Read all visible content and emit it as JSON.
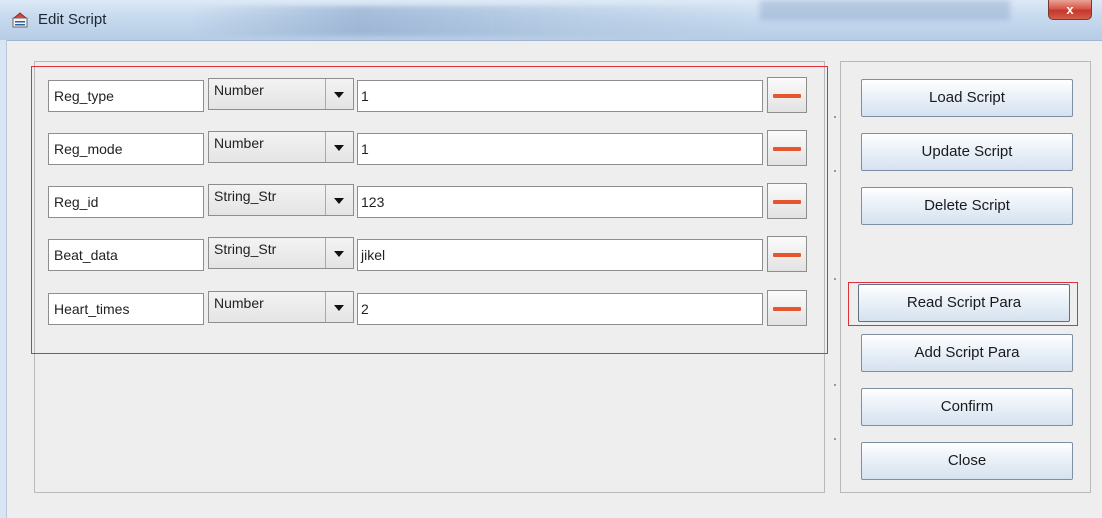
{
  "window": {
    "title": "Edit Script",
    "close_glyph": "x",
    "icon": "app-icon"
  },
  "params": [
    {
      "name": "Reg_type",
      "type": "Number",
      "value": "1"
    },
    {
      "name": "Reg_mode",
      "type": "Number",
      "value": "1"
    },
    {
      "name": "Reg_id",
      "type": "String_Str",
      "value": "123"
    },
    {
      "name": "Beat_data",
      "type": "String_Str",
      "value": "jikel"
    },
    {
      "name": "Heart_times",
      "type": "Number",
      "value": "2"
    }
  ],
  "buttons": {
    "load": "Load Script",
    "update": "Update Script",
    "delete": "Delete Script",
    "read_para": "Read Script Para",
    "add_para": "Add Script Para",
    "confirm": "Confirm",
    "close": "Close"
  },
  "colors": {
    "highlight": "#e0303a",
    "remove_bar": "#e8542d"
  }
}
